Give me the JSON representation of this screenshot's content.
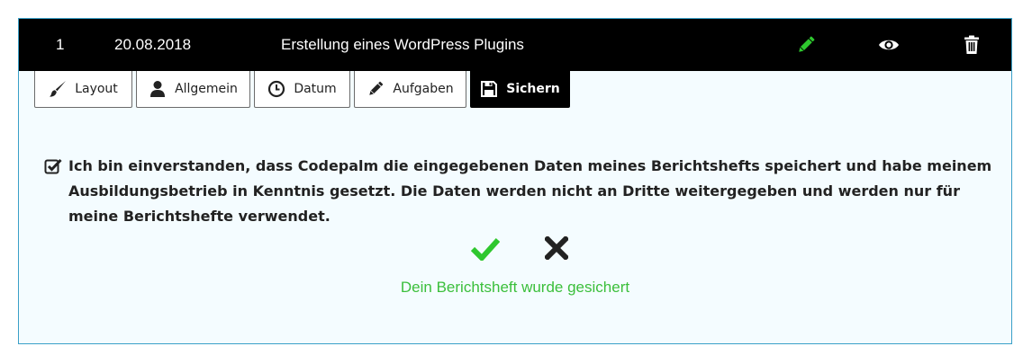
{
  "row": {
    "number": "1",
    "date": "20.08.2018",
    "title": "Erstellung eines WordPress Plugins"
  },
  "row_actions": [
    {
      "icon": "pencil-icon",
      "color": "#2ec72e"
    },
    {
      "icon": "eye-icon",
      "color": "#ffffff"
    },
    {
      "icon": "trash-icon",
      "color": "#ffffff"
    }
  ],
  "tabs": [
    {
      "label": "Layout",
      "icon": "brush-icon",
      "active": false
    },
    {
      "label": "Allgemein",
      "icon": "user-icon",
      "active": false
    },
    {
      "label": "Datum",
      "icon": "clock-icon",
      "active": false
    },
    {
      "label": "Aufgaben",
      "icon": "pencil-icon",
      "active": false
    },
    {
      "label": "Sichern",
      "icon": "floppy-disk-icon",
      "active": true
    }
  ],
  "consent": {
    "checked": true,
    "text": "Ich bin einverstanden, dass Codepalm die eingegebenen Daten meines Berichtshefts speichert und habe meinem Ausbildungsbetrieb in Kenntnis gesetzt. Die Daten werden nicht an Dritte weitergegeben und werden nur für meine Berichtshefte verwendet."
  },
  "confirm": {
    "icon": "checkmark-icon",
    "color": "#2ec72e"
  },
  "cancel": {
    "icon": "x-icon",
    "color": "#222222"
  },
  "status": {
    "message": "Dein Berichtsheft wurde gesichert",
    "color": "#3bbf3b"
  },
  "colors": {
    "accent_border": "#3aa0c8",
    "panel_background": "#f4fcff",
    "header_background": "#000000"
  }
}
